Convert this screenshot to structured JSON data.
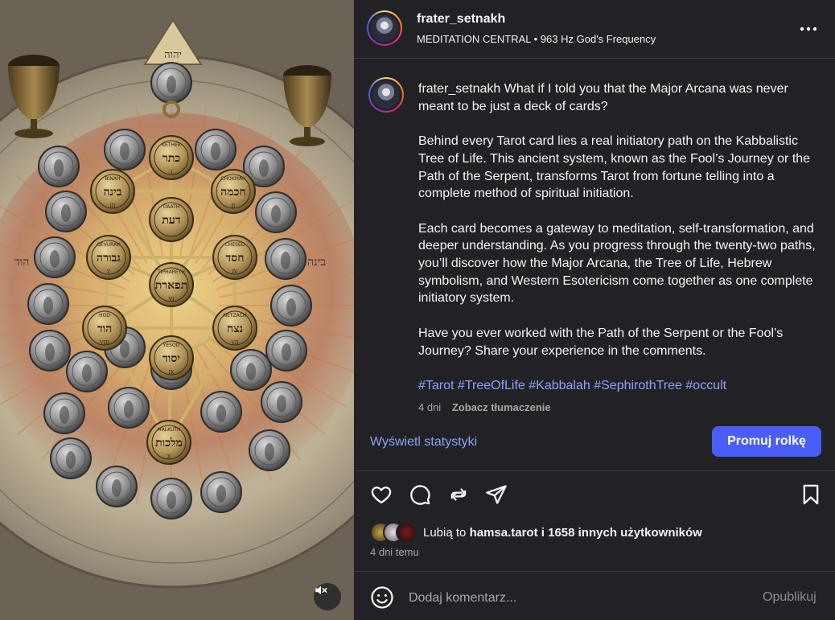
{
  "media": {
    "type": "video",
    "mute_icon": "speaker-muted-icon",
    "emblem_text": "יהוה",
    "sephiroth": [
      {
        "hebrew": "כתר",
        "name": "KETHER",
        "num": "I"
      },
      {
        "hebrew": "בינה",
        "name": "BINAH",
        "num": "III"
      },
      {
        "hebrew": "חכמה",
        "name": "CHOKMAH",
        "num": "II"
      },
      {
        "hebrew": "דעת",
        "name": "DAATH",
        "num": ""
      },
      {
        "hebrew": "גבורה",
        "name": "GEVURAH",
        "num": "V"
      },
      {
        "hebrew": "חסד",
        "name": "CHESED",
        "num": "IV"
      },
      {
        "hebrew": "תפארת",
        "name": "TIPHARETH",
        "num": "VI"
      },
      {
        "hebrew": "הוד",
        "name": "HOD",
        "num": "VIII"
      },
      {
        "hebrew": "נצח",
        "name": "NETZACH",
        "num": "VII"
      },
      {
        "hebrew": "יסוד",
        "name": "YESOD",
        "num": "IX"
      },
      {
        "hebrew": "מלכות",
        "name": "MALKUTH",
        "num": "X"
      }
    ],
    "side_text_left": "הוד",
    "side_text_right": "בינה"
  },
  "header": {
    "username": "frater_setnakh",
    "subtitle": "MEDITATION CENTRAL • 963 Hz God's Frequency",
    "more_icon": "more-options-icon"
  },
  "caption": {
    "username": "frater_setnakh",
    "first_line": "What if I told you that the Major Arcana was never meant to be just a deck of cards?",
    "paragraph_2": "Behind every Tarot card lies a real initiatory path on the Kabbalistic Tree of Life. This ancient system, known as the Fool’s Journey or the Path of the Serpent, transforms Tarot from fortune telling into a complete method of spiritual initiation.",
    "paragraph_3": "Each card becomes a gateway to meditation, self-transformation, and deeper understanding. As you progress through the twenty-two paths, you’ll discover how the Major Arcana, the Tree of Life, Hebrew symbolism, and Western Esotericism come together as one complete initiatory system.",
    "paragraph_4": "Have you ever worked with the Path of the Serpent or the Fool’s Journey? Share your experience in the comments.",
    "hashtags": [
      "#Tarot",
      "#TreeOfLife",
      "#Kabbalah",
      "#SephirothTree",
      "#occult"
    ],
    "time": "4 dni",
    "translate_label": "Zobacz tłumaczenie"
  },
  "stats_link": "Wyświetl statystyki",
  "promote_label": "Promuj rolkę",
  "actions": {
    "like_icon": "heart-icon",
    "comment_icon": "comment-icon",
    "repost_icon": "repost-icon",
    "share_icon": "send-icon",
    "save_icon": "bookmark-icon"
  },
  "likes": {
    "prefix": "Lubią to",
    "user": "hamsa.tarot",
    "suffix": "i 1658 innych użytkowników"
  },
  "time_ago": "4 dni temu",
  "comment": {
    "placeholder": "Dodaj komentarz...",
    "publish_label": "Opublikuj",
    "emoji_icon": "emoji-icon"
  }
}
